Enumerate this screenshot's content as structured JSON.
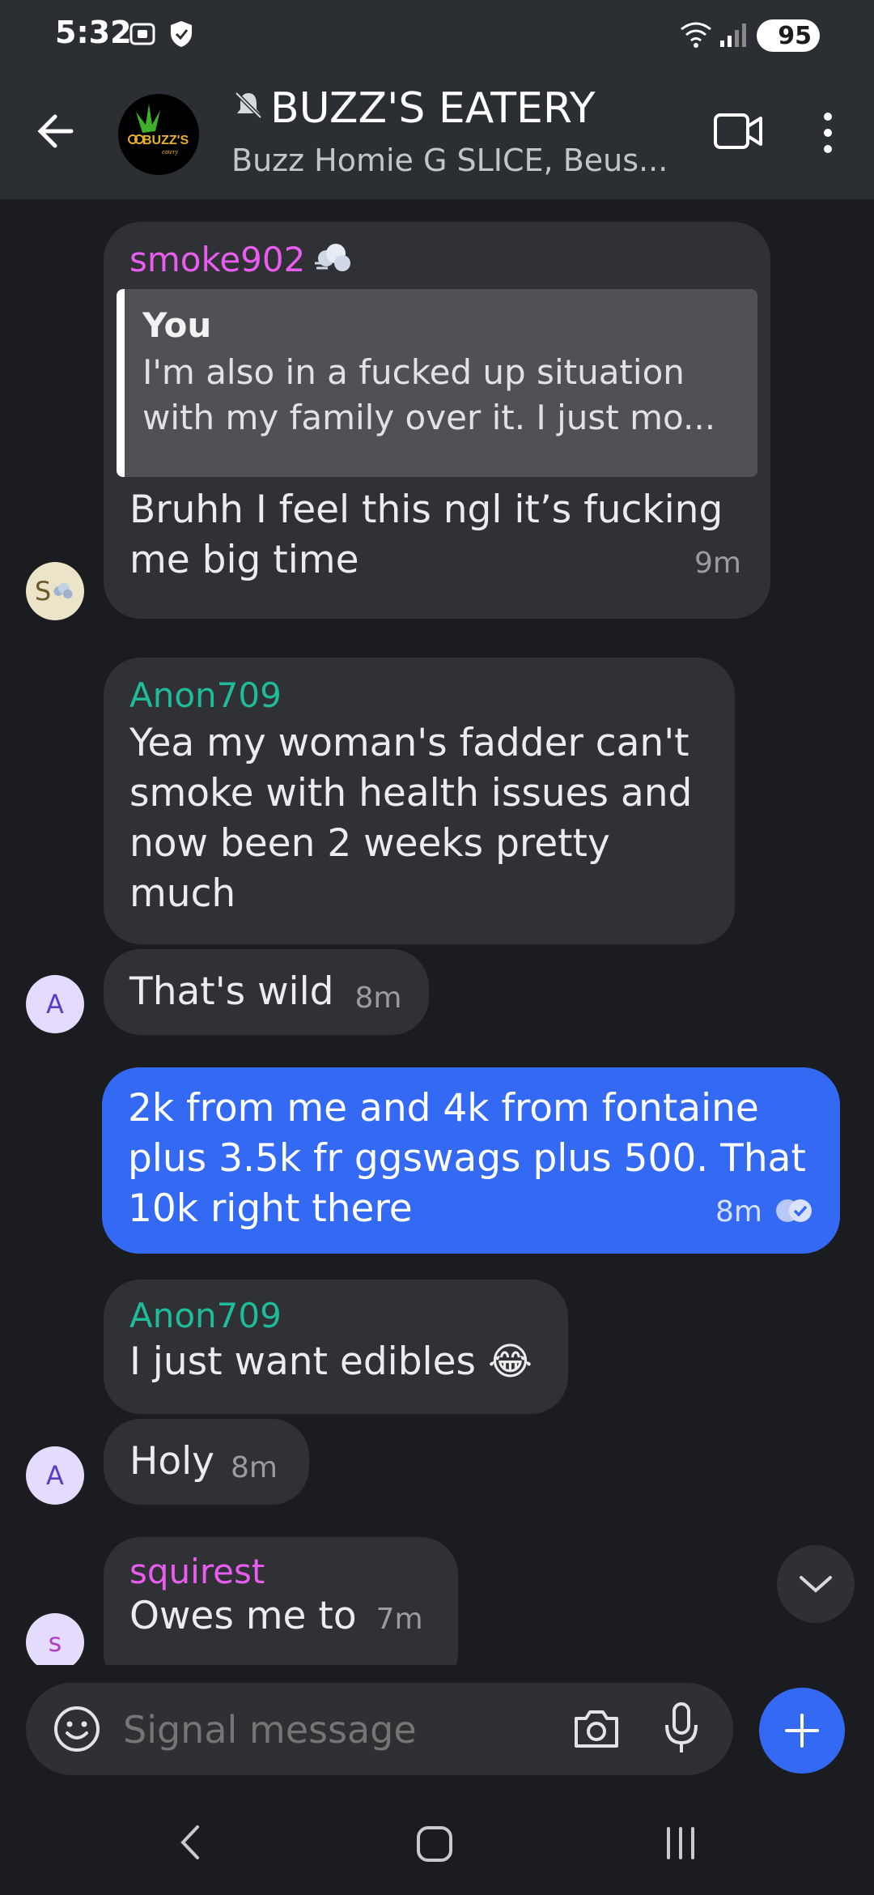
{
  "status": {
    "time": "5:32",
    "battery": "95"
  },
  "header": {
    "title": "BUZZ'S EATERY",
    "subtitle": "Buzz Homie G SLICE, Beus...",
    "logo_text": "BUZZ'S"
  },
  "messages": [
    {
      "sender": "smoke902",
      "sender_color": "#e95cf0",
      "quote_author": "You",
      "quote_line1": "I'm also in a fucked up situation",
      "quote_line2": "with my family over it. I just mo...",
      "line1": "Bruhh I feel this ngl it’s fucking",
      "line2": "me big time",
      "time": "9m",
      "avatar": "S"
    },
    {
      "sender": "Anon709",
      "sender_color": "#1ebc9a",
      "line1": "Yea my woman's fadder can't",
      "line2": "smoke with health issues and",
      "line3": "now been 2 weeks pretty",
      "line4": "much"
    },
    {
      "text": "That's wild",
      "time": "8m",
      "avatar": "A"
    },
    {
      "line1": "2k from me and 4k from fontaine",
      "line2": "plus 3.5k fr ggswags plus 500. That",
      "line3": "10k right there",
      "time": "8m",
      "outgoing": true
    },
    {
      "sender": "Anon709",
      "sender_color": "#1ebc9a",
      "text": "I just want edibles 😂"
    },
    {
      "text": "Holy",
      "time": "8m",
      "avatar": "A"
    },
    {
      "sender": "squirest",
      "sender_color": "#e95cf0",
      "text": "Owes me  to",
      "time": "7m",
      "avatar": "s"
    }
  ],
  "composer": {
    "placeholder": "Signal message"
  },
  "colors": {
    "accent": "#3469f4",
    "bubble": "#303134",
    "background": "#1b1c1f"
  }
}
